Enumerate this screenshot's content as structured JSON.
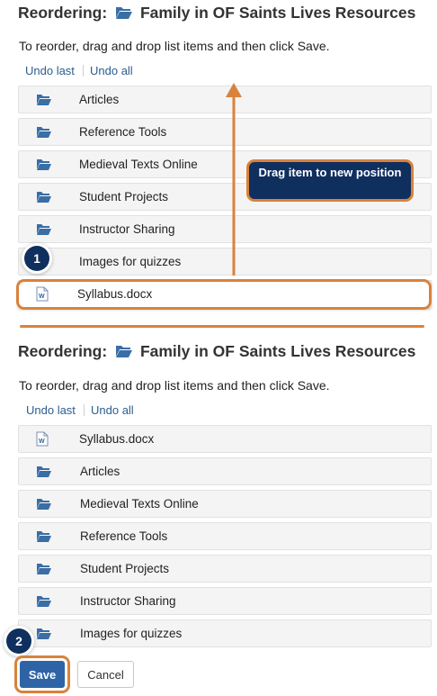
{
  "top": {
    "title_prefix": "Reordering:",
    "title_name": "Family in OF Saints Lives Resources",
    "instructions": "To reorder, drag and drop list items and then click Save.",
    "undo_last": "Undo last",
    "undo_all": "Undo all",
    "items": [
      {
        "label": "Articles",
        "icon": "folder-icon"
      },
      {
        "label": "Reference Tools",
        "icon": "folder-icon"
      },
      {
        "label": "Medieval Texts Online",
        "icon": "folder-icon"
      },
      {
        "label": "Student Projects",
        "icon": "folder-icon"
      },
      {
        "label": "Instructor Sharing",
        "icon": "folder-icon"
      },
      {
        "label": "Images for quizzes",
        "icon": "folder-icon"
      },
      {
        "label": "Syllabus.docx",
        "icon": "word-doc-icon"
      }
    ],
    "callout": "Drag item to new position",
    "step_badge": "1"
  },
  "bottom": {
    "title_prefix": "Reordering:",
    "title_name": "Family in OF Saints Lives Resources",
    "instructions": "To reorder, drag and drop list items and then click Save.",
    "undo_last": "Undo last",
    "undo_all": "Undo all",
    "items": [
      {
        "label": "Syllabus.docx",
        "icon": "word-doc-icon"
      },
      {
        "label": "Articles",
        "icon": "folder-icon"
      },
      {
        "label": "Medieval Texts Online",
        "icon": "folder-icon"
      },
      {
        "label": "Reference Tools",
        "icon": "folder-icon"
      },
      {
        "label": "Student Projects",
        "icon": "folder-icon"
      },
      {
        "label": "Instructor Sharing",
        "icon": "folder-icon"
      },
      {
        "label": "Images for quizzes",
        "icon": "folder-icon"
      }
    ],
    "step_badge": "2",
    "save_label": "Save",
    "cancel_label": "Cancel"
  },
  "colors": {
    "accent_orange": "#d9823b",
    "navy": "#0f2f5f",
    "link_blue": "#2c5d91",
    "save_blue": "#2e64a6",
    "folder_blue": "#3a6ea5"
  }
}
